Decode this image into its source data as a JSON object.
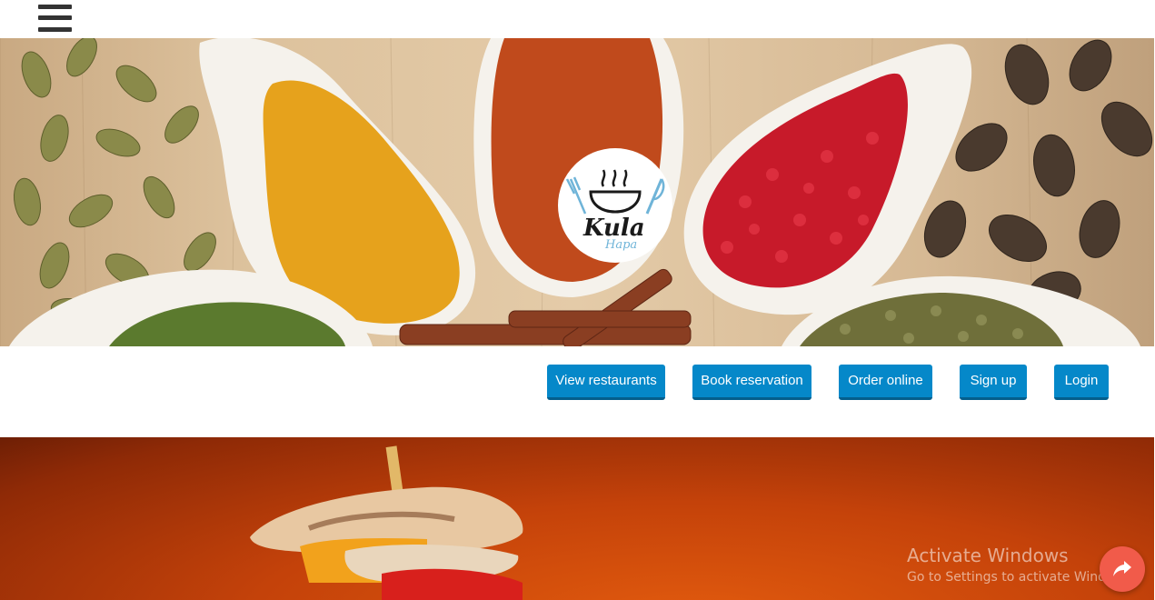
{
  "header": {
    "menu_icon": "hamburger-menu-icon"
  },
  "hero": {
    "logo": {
      "line1": "Kula",
      "line2": "Hapa"
    }
  },
  "nav": {
    "buttons": [
      {
        "label": "View restaurants"
      },
      {
        "label": "Book reservation"
      },
      {
        "label": "Order online"
      },
      {
        "label": "Sign up"
      },
      {
        "label": "Login"
      }
    ]
  },
  "watermark": {
    "title": "Activate Windows",
    "subtitle": "Go to Settings to activate Windows."
  },
  "fab": {
    "icon": "share-arrow-icon"
  },
  "colors": {
    "button_bg": "#0588c9",
    "fab_bg": "#f15b4a"
  }
}
